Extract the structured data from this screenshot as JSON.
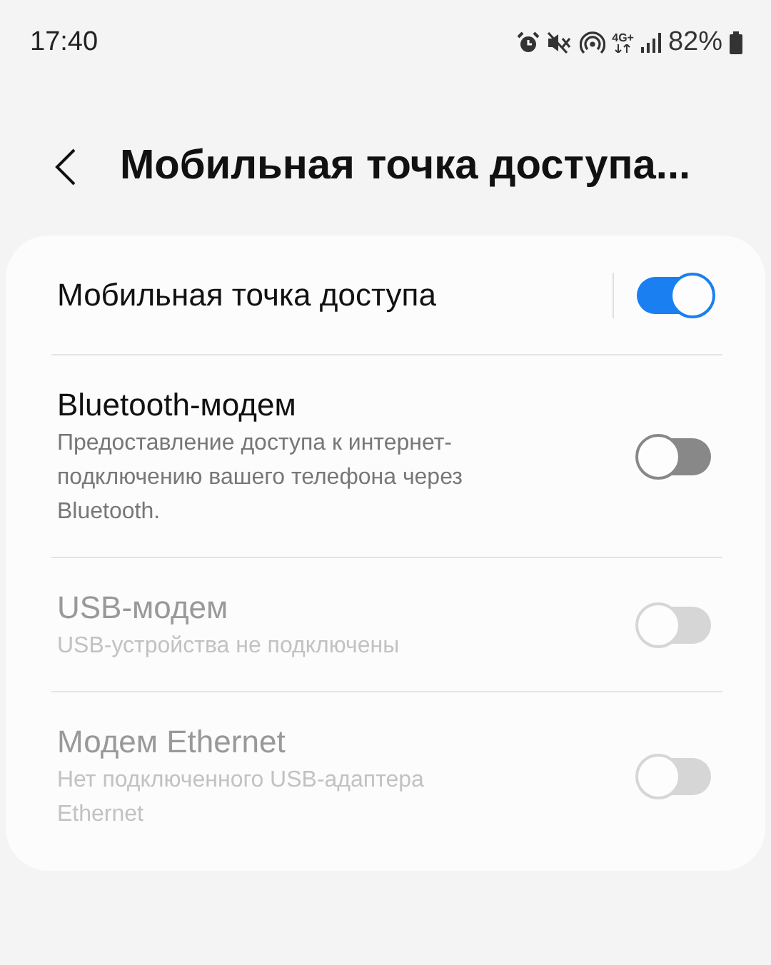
{
  "status_bar": {
    "time": "17:40",
    "network_type": "4G+",
    "battery": "82%"
  },
  "header": {
    "title": "Мобильная точка доступа..."
  },
  "settings": [
    {
      "title": "Мобильная точка доступа",
      "on": true,
      "disabled": false,
      "split": true
    },
    {
      "title": "Bluetooth-модем",
      "subtitle": "Предоставление доступа к интернет-подключению вашего телефона через Bluetooth.",
      "on": false,
      "disabled": false,
      "split": false
    },
    {
      "title": "USB-модем",
      "subtitle": "USB-устройства не подключены",
      "on": false,
      "disabled": true,
      "split": false
    },
    {
      "title": "Модем Ethernet",
      "subtitle": "Нет подключенного USB-адаптера Ethernet",
      "on": false,
      "disabled": true,
      "split": false
    }
  ]
}
